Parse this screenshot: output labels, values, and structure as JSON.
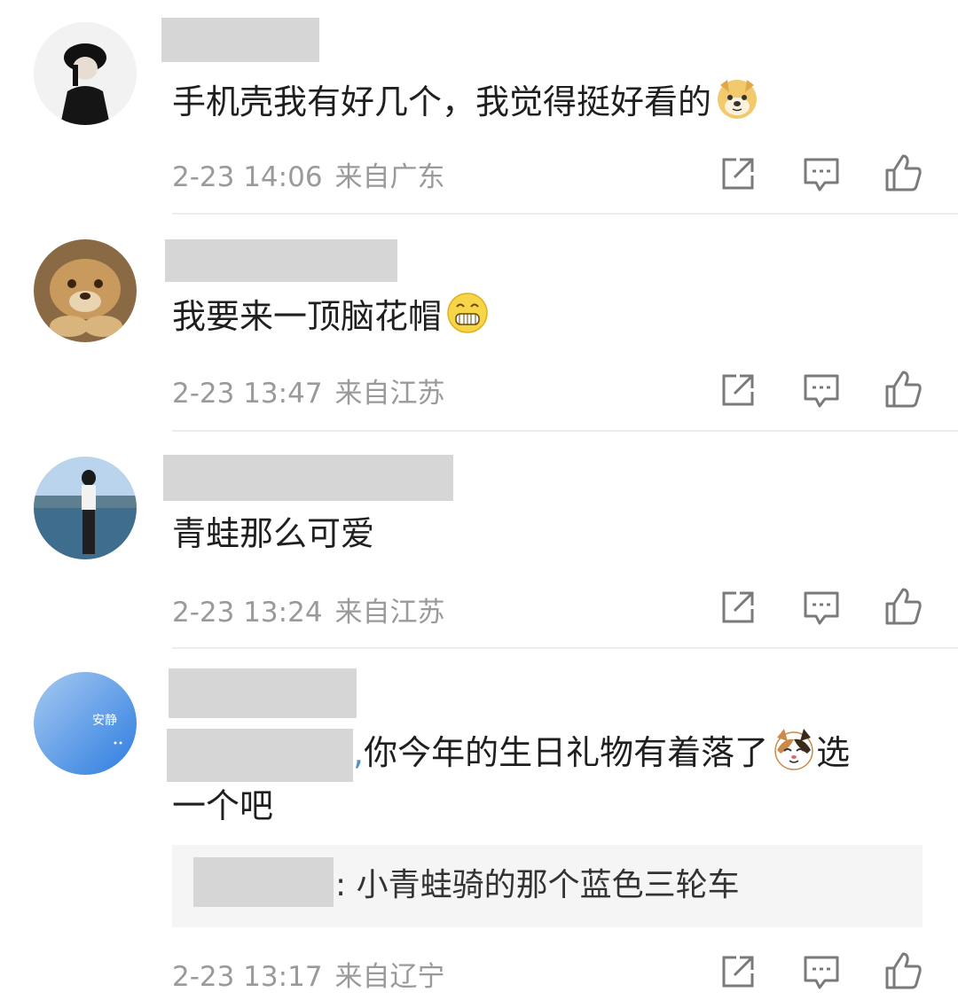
{
  "comments": [
    {
      "text": "手机壳我有好几个，我觉得挺好看的",
      "emoji": "doge-emoji",
      "time": "2-23 14:06",
      "location": "来自广东"
    },
    {
      "text": "我要来一顶脑花帽",
      "emoji": "grin-emoji",
      "time": "2-23 13:47",
      "location": "来自江苏"
    },
    {
      "text": "青蛙那么可爱",
      "time": "2-23 13:24",
      "location": "来自江苏"
    },
    {
      "mention_separator": ",",
      "text_part1": "你今年的生日礼物有着落了",
      "emoji": "cat-emoji",
      "text_part2": "选",
      "text_line2": "一个吧",
      "avatar_text": "安静",
      "quote": ": 小青蛙骑的那个蓝色三轮车",
      "time": "2-23 13:17",
      "location": "来自辽宁"
    }
  ],
  "icons": {
    "share": "share-icon",
    "comment": "comment-icon",
    "like": "like-icon"
  },
  "colors": {
    "text": "#1f1f1f",
    "meta": "#9a9a9a",
    "redaction": "#d6d6d6",
    "divider": "#ececec",
    "quote_bg": "#f5f5f5"
  }
}
